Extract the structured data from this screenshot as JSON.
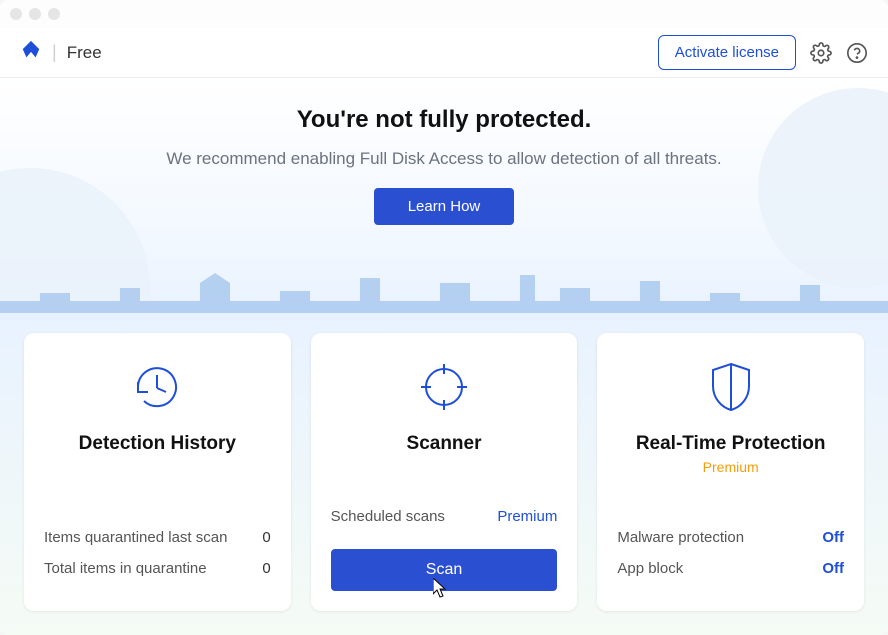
{
  "header": {
    "product_tier": "Free",
    "activate_label": "Activate license"
  },
  "hero": {
    "title": "You're not fully protected.",
    "subtitle": "We recommend enabling Full Disk Access to allow detection of all threats.",
    "learn_label": "Learn How"
  },
  "cards": {
    "history": {
      "title": "Detection History",
      "rows": [
        {
          "label": "Items quarantined last scan",
          "value": "0"
        },
        {
          "label": "Total items in quarantine",
          "value": "0"
        }
      ]
    },
    "scanner": {
      "title": "Scanner",
      "rows": [
        {
          "label": "Scheduled scans",
          "value": "Premium"
        }
      ],
      "scan_label": "Scan"
    },
    "realtime": {
      "title": "Real-Time Protection",
      "subtitle": "Premium",
      "rows": [
        {
          "label": "Malware protection",
          "value": "Off"
        },
        {
          "label": "App block",
          "value": "Off"
        }
      ]
    }
  }
}
